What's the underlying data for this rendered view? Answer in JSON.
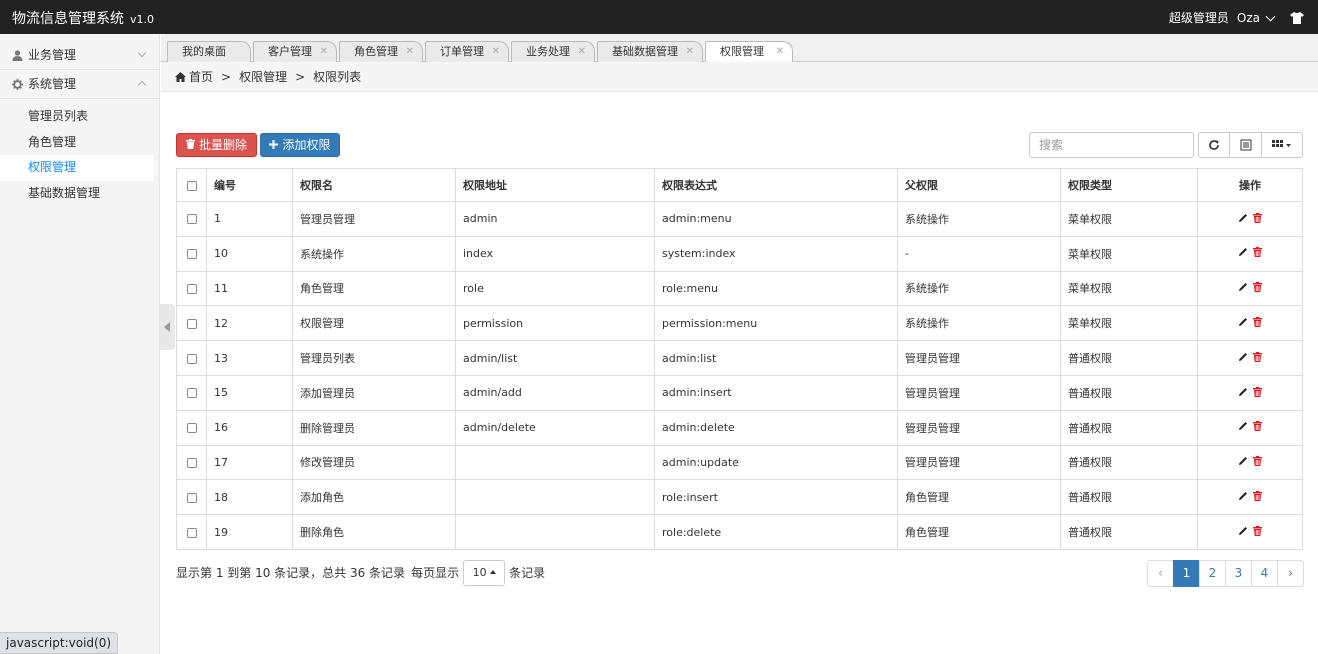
{
  "app": {
    "title": "物流信息管理系统",
    "version": "v1.0"
  },
  "header": {
    "user_role": "超级管理员",
    "user_name": "Oza",
    "icons": [
      "chevron-down-icon",
      "shirt-icon"
    ]
  },
  "sidebar": {
    "groups": [
      {
        "label": "业务管理",
        "icon": "user-icon",
        "expanded": false
      },
      {
        "label": "系统管理",
        "icon": "gear-icon",
        "expanded": true
      }
    ],
    "items": [
      {
        "label": "管理员列表",
        "active": false
      },
      {
        "label": "角色管理",
        "active": false
      },
      {
        "label": "权限管理",
        "active": true
      },
      {
        "label": "基础数据管理",
        "active": false
      }
    ]
  },
  "tabs": [
    {
      "label": "我的桌面",
      "closable": false,
      "active": false
    },
    {
      "label": "客户管理",
      "closable": true,
      "active": false
    },
    {
      "label": "角色管理",
      "closable": true,
      "active": false
    },
    {
      "label": "订单管理",
      "closable": true,
      "active": false
    },
    {
      "label": "业务处理",
      "closable": true,
      "active": false
    },
    {
      "label": "基础数据管理",
      "closable": true,
      "active": false
    },
    {
      "label": "权限管理",
      "closable": true,
      "active": true
    }
  ],
  "breadcrumb": [
    "首页",
    "权限管理",
    "权限列表"
  ],
  "toolbar": {
    "batch_delete_label": "批量删除",
    "add_label": "添加权限",
    "search_placeholder": "搜索"
  },
  "table": {
    "columns": [
      "编号",
      "权限名",
      "权限地址",
      "权限表达式",
      "父权限",
      "权限类型",
      "操作"
    ],
    "rows": [
      {
        "id": "1",
        "name": "管理员管理",
        "url": "admin",
        "expr": "admin:menu",
        "parent": "系统操作",
        "type": "菜单权限"
      },
      {
        "id": "10",
        "name": "系统操作",
        "url": "index",
        "expr": "system:index",
        "parent": "-",
        "type": "菜单权限"
      },
      {
        "id": "11",
        "name": "角色管理",
        "url": "role",
        "expr": "role:menu",
        "parent": "系统操作",
        "type": "菜单权限"
      },
      {
        "id": "12",
        "name": "权限管理",
        "url": "permission",
        "expr": "permission:menu",
        "parent": "系统操作",
        "type": "菜单权限"
      },
      {
        "id": "13",
        "name": "管理员列表",
        "url": "admin/list",
        "expr": "admin:list",
        "parent": "管理员管理",
        "type": "普通权限"
      },
      {
        "id": "15",
        "name": "添加管理员",
        "url": "admin/add",
        "expr": "admin:insert",
        "parent": "管理员管理",
        "type": "普通权限"
      },
      {
        "id": "16",
        "name": "删除管理员",
        "url": "admin/delete",
        "expr": "admin:delete",
        "parent": "管理员管理",
        "type": "普通权限"
      },
      {
        "id": "17",
        "name": "修改管理员",
        "url": "",
        "expr": "admin:update",
        "parent": "管理员管理",
        "type": "普通权限"
      },
      {
        "id": "18",
        "name": "添加角色",
        "url": "",
        "expr": "role:insert",
        "parent": "角色管理",
        "type": "普通权限"
      },
      {
        "id": "19",
        "name": "删除角色",
        "url": "",
        "expr": "role:delete",
        "parent": "角色管理",
        "type": "普通权限"
      }
    ]
  },
  "pagination": {
    "info_prefix": "显示第 1 到第 10 条记录，总共 36 条记录",
    "per_page_label": "每页显示",
    "page_size": "10",
    "per_page_suffix": "条记录",
    "prev": "‹",
    "next": "›",
    "pages": [
      "1",
      "2",
      "3",
      "4"
    ],
    "current": "1"
  },
  "statusbar": {
    "text": "javascript:void(0)"
  },
  "colors": {
    "header_bg": "#222222",
    "accent": "#337ab7",
    "danger": "#d9534f",
    "menu_type": "#e0141c",
    "active_link": "#148cf1"
  }
}
